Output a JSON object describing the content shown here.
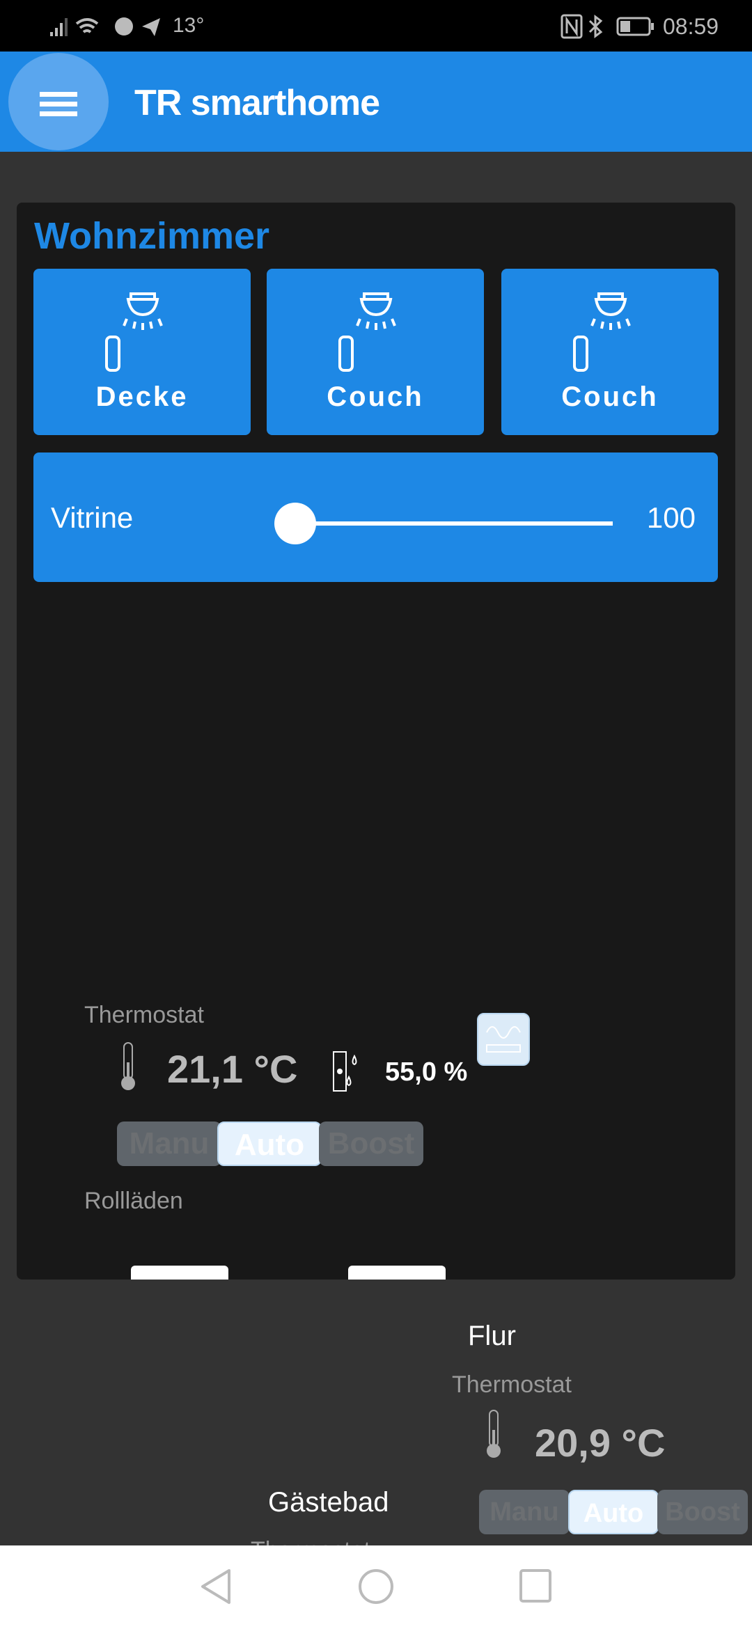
{
  "status_bar": {
    "temperature": "13°",
    "time": "08:59",
    "icons": [
      "signal-icon",
      "wifi-icon",
      "facebook-icon",
      "telegram-icon",
      "nfc-icon",
      "bluetooth-icon",
      "battery-icon"
    ]
  },
  "header": {
    "title": "TR smarthome",
    "menu_icon": "hamburger-menu-icon",
    "color": "#1e88e5"
  },
  "wohnzimmer": {
    "title": "Wohnzimmer",
    "lights": [
      {
        "label": "Decke",
        "icon": "ceiling-light-bulb-icon"
      },
      {
        "label": "Couch",
        "icon": "ceiling-light-bulb-icon"
      },
      {
        "label": "Couch",
        "icon": "ceiling-light-bulb-icon"
      }
    ],
    "dimmer": {
      "label": "Vitrine",
      "value": "100"
    },
    "thermostat": {
      "label": "Thermostat",
      "temperature": "21,1 °C",
      "humidity": "55,0 %",
      "modes": [
        "Manu",
        "Auto",
        "Boost"
      ],
      "active_mode": "Auto"
    },
    "shutters": {
      "label": "Rollläden"
    }
  },
  "flur": {
    "title": "Flur",
    "thermostat": {
      "label": "Thermostat",
      "temperature": "20,9 °C",
      "modes": [
        "Manu",
        "Auto",
        "Boost"
      ],
      "active_mode": "Auto"
    }
  },
  "gaestebad": {
    "title": "Gästebad",
    "thermostat_label": "Thermostat"
  },
  "nav": {
    "icons": [
      "back-icon",
      "home-icon",
      "recents-icon"
    ]
  }
}
